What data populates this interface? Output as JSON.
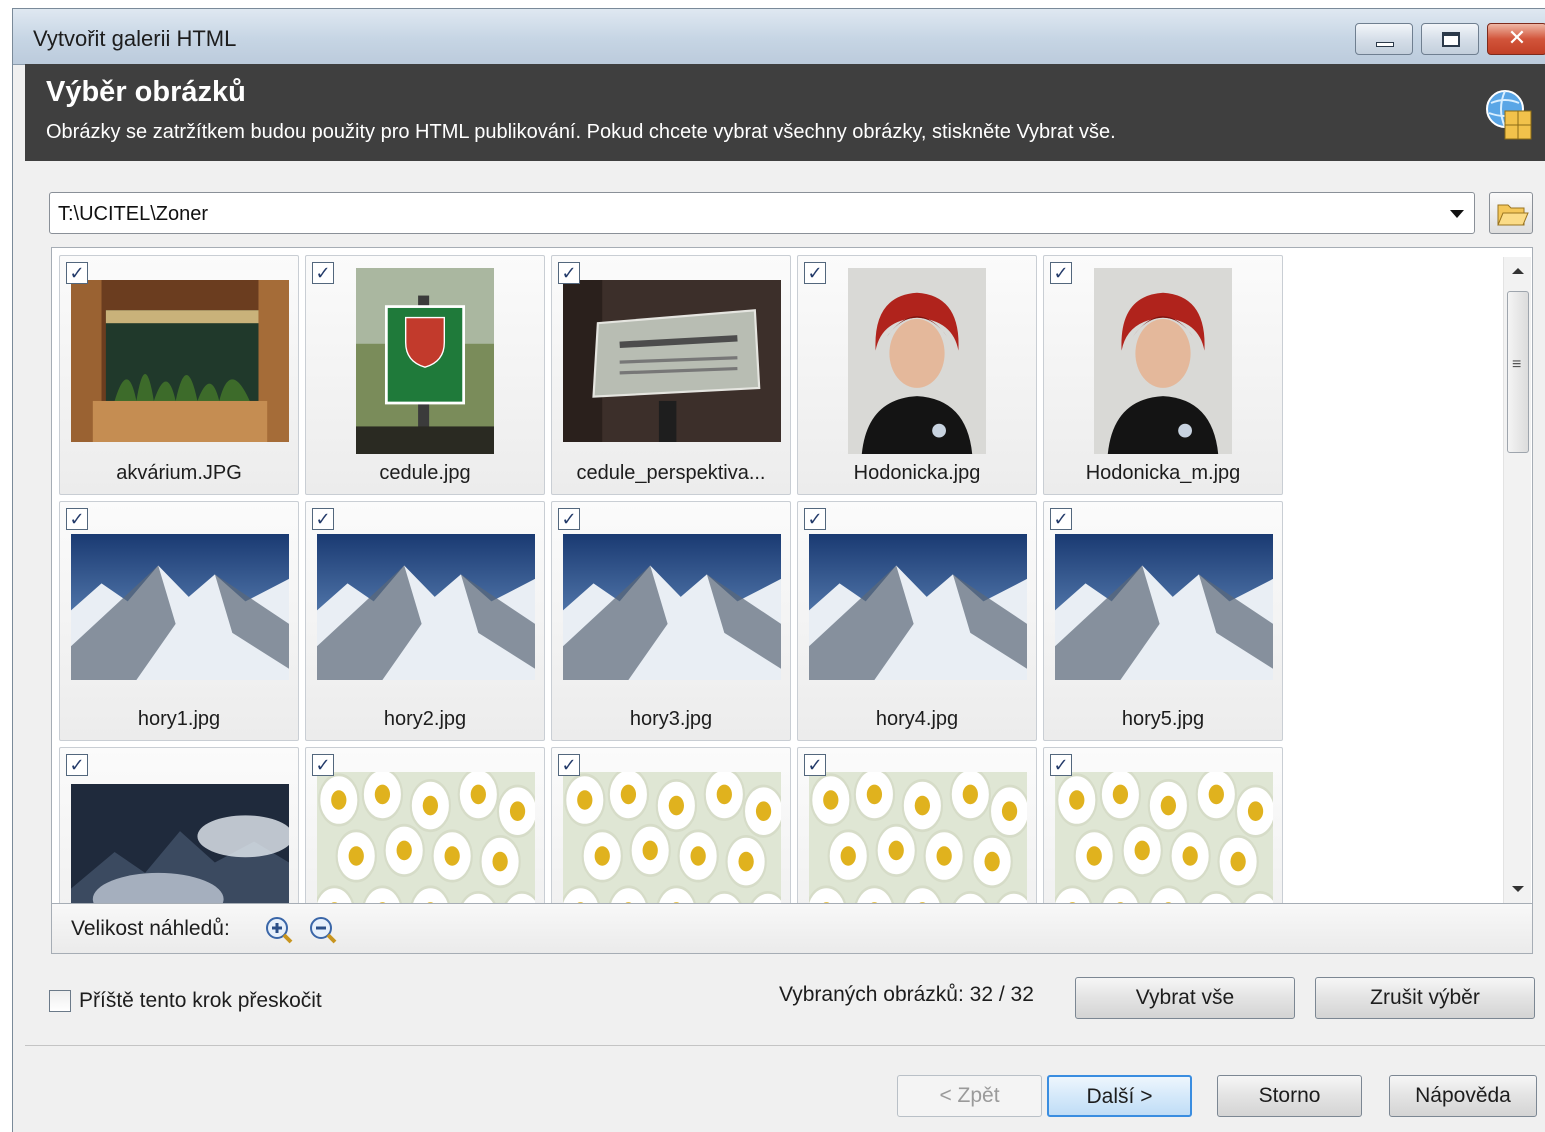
{
  "window": {
    "title": "Vytvořit galerii HTML"
  },
  "header": {
    "title": "Výběr obrázků",
    "description": "Obrázky se zatržítkem budou použity pro HTML publikování. Pokud chcete vybrat všechny obrázky, stiskněte Vybrat vše."
  },
  "path": {
    "value": "T:\\UCITEL\\Zoner"
  },
  "gallery": {
    "items": [
      {
        "caption": "akvárium.JPG",
        "checked": true,
        "icon": "aquarium-photo"
      },
      {
        "caption": "cedule.jpg",
        "checked": true,
        "icon": "sign-photo"
      },
      {
        "caption": "cedule_perspektiva...",
        "checked": true,
        "icon": "sign-perspective-photo"
      },
      {
        "caption": "Hodonicka.jpg",
        "checked": true,
        "icon": "portrait-photo"
      },
      {
        "caption": "Hodonicka_m.jpg",
        "checked": true,
        "icon": "portrait-photo"
      },
      {
        "caption": "hory1.jpg",
        "checked": true,
        "icon": "mountain-photo"
      },
      {
        "caption": "hory2.jpg",
        "checked": true,
        "icon": "mountain-photo"
      },
      {
        "caption": "hory3.jpg",
        "checked": true,
        "icon": "mountain-photo"
      },
      {
        "caption": "hory4.jpg",
        "checked": true,
        "icon": "mountain-photo"
      },
      {
        "caption": "hory5.jpg",
        "checked": true,
        "icon": "mountain-photo"
      },
      {
        "caption": "",
        "checked": true,
        "icon": "mountain-clouds-photo"
      },
      {
        "caption": "",
        "checked": true,
        "icon": "daisies-photo"
      },
      {
        "caption": "",
        "checked": true,
        "icon": "daisies-photo"
      },
      {
        "caption": "",
        "checked": true,
        "icon": "daisies-photo"
      },
      {
        "caption": "",
        "checked": true,
        "icon": "daisies-photo"
      }
    ],
    "checkmark": "✓"
  },
  "thumb_size": {
    "label": "Velikost náhledů:"
  },
  "skip": {
    "label": "Příště tento krok přeskočit",
    "checked": false
  },
  "selection": {
    "count_text": "Vybraných obrázků: 32 / 32",
    "select_all": "Vybrat vše",
    "clear": "Zrušit výběr"
  },
  "footer": {
    "back": "< Zpět",
    "next": "Další >",
    "cancel": "Storno",
    "help": "Nápověda"
  },
  "colors": {
    "header_bg": "#3f3f3f",
    "default_button_border": "#3a8de0",
    "checkmark": "#243b6a"
  }
}
